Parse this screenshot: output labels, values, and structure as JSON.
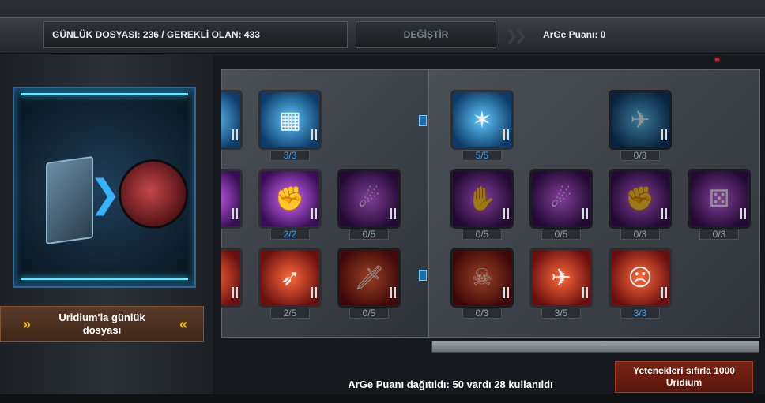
{
  "header": {
    "daily_file": "GÜNLÜK DOSYASI: 236 / GEREKLİ OLAN: 433",
    "change_button": "DEĞİŞTİR",
    "arge_points": "ArGe Puanı: 0"
  },
  "left_panel": {
    "uridium_button": "Uridium'la günlük dosyası"
  },
  "middle_grid": [
    {
      "row": 1,
      "items": [
        {
          "icon": "partial-blue-icon",
          "count": "",
          "tier": "blue"
        },
        {
          "icon": "ammo-crate-icon",
          "count": "3/3",
          "tier": "blue"
        },
        {
          "icon": "empty",
          "count": "",
          "tier": "none"
        }
      ]
    },
    {
      "row": 2,
      "items": [
        {
          "icon": "partial-purple-icon",
          "count": "",
          "tier": "purple"
        },
        {
          "icon": "fist-icon",
          "count": "2/2",
          "tier": "purple"
        },
        {
          "icon": "meteor-punch-icon",
          "count": "0/5",
          "tier": "purple"
        }
      ]
    },
    {
      "row": 3,
      "items": [
        {
          "icon": "partial-red-icon",
          "count": "",
          "tier": "red"
        },
        {
          "icon": "rifle-icon",
          "count": "2/5",
          "tier": "red"
        },
        {
          "icon": "flaming-blade-icon",
          "count": "0/5",
          "tier": "red"
        }
      ]
    }
  ],
  "right_grid": [
    {
      "row": 1,
      "items": [
        {
          "icon": "plasma-spear-icon",
          "count": "5/5",
          "tier": "blue"
        },
        {
          "icon": "empty",
          "count": "",
          "tier": "none"
        },
        {
          "icon": "starship-icon",
          "count": "0/3",
          "tier": "blue"
        },
        {
          "icon": "empty",
          "count": "",
          "tier": "none"
        }
      ]
    },
    {
      "row": 2,
      "items": [
        {
          "icon": "grab-hand-icon",
          "count": "0/5",
          "tier": "purple"
        },
        {
          "icon": "meteor-punch-icon",
          "count": "0/5",
          "tier": "purple"
        },
        {
          "icon": "fist-icon",
          "count": "0/3",
          "tier": "purple"
        },
        {
          "icon": "dice-icon",
          "count": "0/3",
          "tier": "purple"
        }
      ]
    },
    {
      "row": 3,
      "items": [
        {
          "icon": "skull-icon",
          "count": "0/3",
          "tier": "red"
        },
        {
          "icon": "jet-icon",
          "count": "3/5",
          "tier": "red"
        },
        {
          "icon": "face-hit-icon",
          "count": "3/3",
          "tier": "red"
        },
        {
          "icon": "empty",
          "count": "",
          "tier": "none"
        }
      ]
    }
  ],
  "footer": {
    "status": "ArGe Puanı dağıtıldı: 50 vardı 28 kullanıldı",
    "reset_button": "Yetenekleri sıfırla 1000 Uridium"
  },
  "colors": {
    "blue_tier": "#3aa6ff",
    "purple_tier": "#b14be6",
    "red_tier": "#e0321e",
    "accent_yellow": "#f4b800"
  }
}
